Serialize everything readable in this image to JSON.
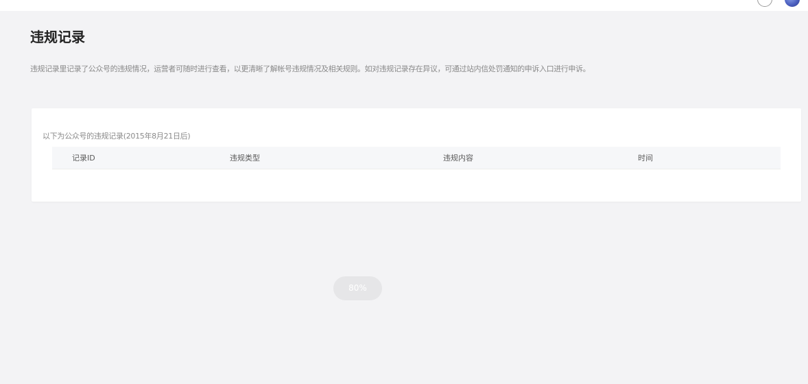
{
  "page": {
    "title": "违规记录",
    "description": "违规记录里记录了公众号的违规情况，运营者可随时进行查看，以更清晰了解帐号违规情况及相关规则。如对违规记录存在异议，可通过站内信处罚通知的申诉入口进行申诉。"
  },
  "record_card": {
    "caption": "以下为公众号的违规记录(2015年8月21日后)",
    "columns": [
      "记录ID",
      "违规类型",
      "违规内容",
      "时间"
    ],
    "rows": []
  },
  "loading": {
    "progress_label": "80%",
    "progress": 0.8
  },
  "icons": {
    "help": "help-circle-icon",
    "avatar": "user-avatar"
  }
}
